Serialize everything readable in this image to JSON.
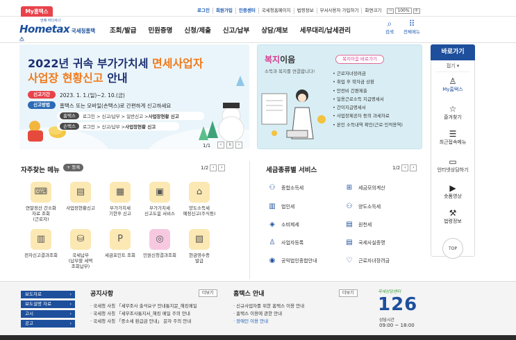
{
  "topbar": {
    "my_tab": "My홈택스",
    "links": [
      "로그인",
      "회원가입",
      "인증센터",
      "국세청홈페이지",
      "법령정보",
      "부서사용자 가입하기",
      "화면크기"
    ],
    "zoom_minus": "－",
    "zoom_value": "100%",
    "zoom_plus": "＋"
  },
  "header": {
    "logo_main": "Hometax",
    "logo_sub": "국세청홈택스",
    "logo_tag": "언제 어디서나",
    "nav": [
      "조회/발급",
      "민원증명",
      "신청/제출",
      "신고/납부",
      "상담/제보",
      "세무대리/납세관리"
    ],
    "search_label": "검색",
    "menu_label": "전체메뉴"
  },
  "banner1": {
    "title_line1_a": "2022년 귀속 부가가치세 ",
    "title_line1_b": "면세사업자",
    "title_line2_a": "사업장 현황신고",
    "title_line2_b": " 안내",
    "period_label": "신고기간",
    "period_text": "2023. 1. 1.(일)~2. 10.(금)",
    "method_label": "신고방법",
    "method_text": "홈택스 또는 모바일(손택스)로 간편하게 신고하세요",
    "row1_tag": "홈택스",
    "row1_text": "로그인 > 신고/납부 > 일반신고 > ",
    "row1_bold": "사업장현황 신고",
    "row2_tag": "손택스",
    "row2_text": "로그인 > 신고/납부 > ",
    "row2_bold": "사업장현황 신고",
    "page": "1/1"
  },
  "banner2": {
    "title_a": "복지",
    "title_b": "이음",
    "subtitle": "소득과 복지를 연결합니다!",
    "btn": "복지이음 바로가기",
    "items": [
      "근로자녀장려금",
      "취업 후 학자금 상환",
      "안전비 간편제출",
      "일용근로소득 지급명세서",
      "간이지급명세서",
      "사업장제공자 등의 과세자료",
      "본인 소득내역 확인(근로·인적용역)"
    ]
  },
  "right_sidebar": {
    "title": "바로가기",
    "fold": "접기 ▾",
    "items": [
      {
        "icon": "person-icon",
        "glyph": "♙",
        "label": "My홈택스"
      },
      {
        "icon": "star-icon",
        "glyph": "☆",
        "label": "즐겨찾기"
      },
      {
        "icon": "recent-menu-icon",
        "glyph": "☰",
        "label": "최근접속메뉴"
      },
      {
        "icon": "monitor-icon",
        "glyph": "▭",
        "label": "인터넷상담하기"
      },
      {
        "icon": "play-icon",
        "glyph": "▶",
        "label": "숏폼영상"
      },
      {
        "icon": "gavel-icon",
        "glyph": "⚒",
        "label": "법령정보"
      }
    ],
    "top": "TOP"
  },
  "quick_menu": {
    "title": "자주찾는 메뉴",
    "add": "+ 등록",
    "page": "1/2",
    "items": [
      {
        "icon": "calculator-icon",
        "glyph": "⌨",
        "label": "연말정산 간소화\n자료 조회\n(근로자)"
      },
      {
        "icon": "document-icon",
        "glyph": "▤",
        "label": "사업장현황신고"
      },
      {
        "icon": "vat-icon",
        "glyph": "▦",
        "label": "부가가치세\n기한후 신고"
      },
      {
        "icon": "vat-help-icon",
        "glyph": "▣",
        "label": "부가가치세\n신고도움 서비스"
      },
      {
        "icon": "house-icon",
        "glyph": "⌂",
        "label": "양도소득세\n예정신고(주식등)"
      },
      {
        "icon": "invoice-icon",
        "glyph": "▥",
        "label": "전자신고결과조회"
      },
      {
        "icon": "tax-payment-icon",
        "glyph": "⛁",
        "label": "국세납부\n(납부할 세액\n조회납부)"
      },
      {
        "icon": "points-icon",
        "glyph": "P",
        "label": "세금포인트 조회"
      },
      {
        "icon": "headset-icon",
        "glyph": "◎",
        "label": "민원신청결과조회"
      },
      {
        "icon": "receipt-icon",
        "glyph": "▧",
        "label": "현금영수증\n발급"
      }
    ]
  },
  "tax_services": {
    "title": "세금종류별 서비스",
    "page": "1/2",
    "items": [
      {
        "icon": "comprehensive-tax-icon",
        "glyph": "⚇",
        "label": "종합소득세"
      },
      {
        "icon": "simulator-icon",
        "glyph": "⊞",
        "label": "세금모의계산"
      },
      {
        "icon": "corporate-tax-icon",
        "glyph": "▥",
        "label": "법인세"
      },
      {
        "icon": "transfer-tax-icon",
        "glyph": "⚇",
        "label": "양도소득세"
      },
      {
        "icon": "consumption-tax-icon",
        "glyph": "◈",
        "label": "소비제세"
      },
      {
        "icon": "withholding-tax-icon",
        "glyph": "▤",
        "label": "원천세"
      },
      {
        "icon": "registration-icon",
        "glyph": "♙",
        "label": "사업자등록"
      },
      {
        "icon": "certificate-icon",
        "glyph": "▤",
        "label": "국세사실증명"
      },
      {
        "icon": "public-interest-icon",
        "glyph": "◉",
        "label": "공익법인종합안내"
      },
      {
        "icon": "heart-icon",
        "glyph": "♡",
        "label": "근로자녀장려금"
      }
    ]
  },
  "footer": {
    "buttons": [
      "보도자료",
      "보도설명 자료",
      "고시",
      "공고"
    ],
    "notice_title": "공지사항",
    "notice_more": "더보기",
    "notices": [
      "국세청 사칭 「세무조사 출석요구 안내통지문_해킹메일",
      "국세청 사칭 「세무조사통지서_해킹 메일 주의 안내",
      "국세청 사칭 「종소세 환급금 안내」 문자 주의 안내"
    ],
    "hometax_title": "홈택스 안내",
    "hometax_more": "더보기",
    "hometax_items": [
      "신규사업자를 위한 홈택스 이용 안내",
      "홈택스 이용에 관한 안내",
      "장애인 이용 안내"
    ],
    "call_caption": "국세상담센터",
    "call_number": "126",
    "hours_label": "상담시간",
    "hours": "09:00 ~ 18:00"
  },
  "colors": {
    "brand_blue": "#1d4f9c",
    "accent_orange": "#f07a1a",
    "my_tab_red": "#e8434a"
  }
}
